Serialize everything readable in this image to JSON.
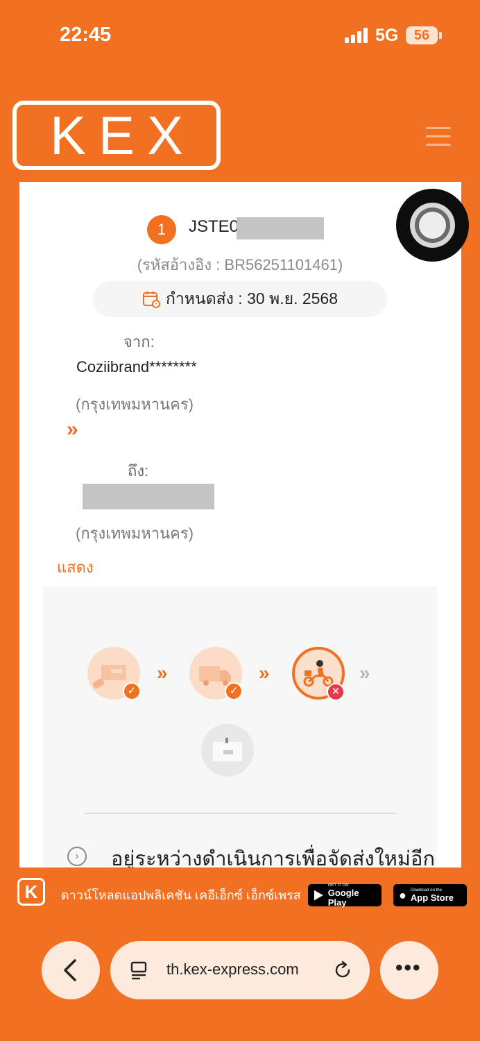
{
  "status_bar": {
    "time": "22:45",
    "network": "5G",
    "battery": "56"
  },
  "header": {
    "logo": "KEX"
  },
  "shipment": {
    "step": "1",
    "tracking_prefix": "JSTE0",
    "reference": "(รหัสอ้างอิง : BR56251101461)",
    "due_date": "กำหนดส่ง : 30 พ.ย. 2568",
    "from_label": "จาก:",
    "sender_name": "Coziibrand********",
    "sender_province": "(กรุงเทพมหานคร)",
    "to_label": "ถึง:",
    "receiver_province": "(กรุงเทพมหานคร)",
    "show_label": "แสดง"
  },
  "tracking_panel": {
    "status_text": "อยู่ระหว่างดำเนินการเพื่อจัดส่งใหม่อีก",
    "steps": [
      "parcel-received",
      "in-transit",
      "out-for-delivery",
      "delivered"
    ],
    "colors": {
      "done": "#f27022",
      "failed": "#e8364a",
      "pending": "#c8c8c8"
    }
  },
  "app_banner": {
    "logo": "K",
    "text": "ดาวน์โหลดแอปพลิเคชัน เคอีเอ็กซ์ เอ็กซ์เพรส",
    "google_small": "GET IT ON",
    "google_big": "Google Play",
    "apple_small": "Download on the",
    "apple_big": "App Store"
  },
  "browser": {
    "url": "th.kex-express.com",
    "back": "‹",
    "more": "•••"
  }
}
